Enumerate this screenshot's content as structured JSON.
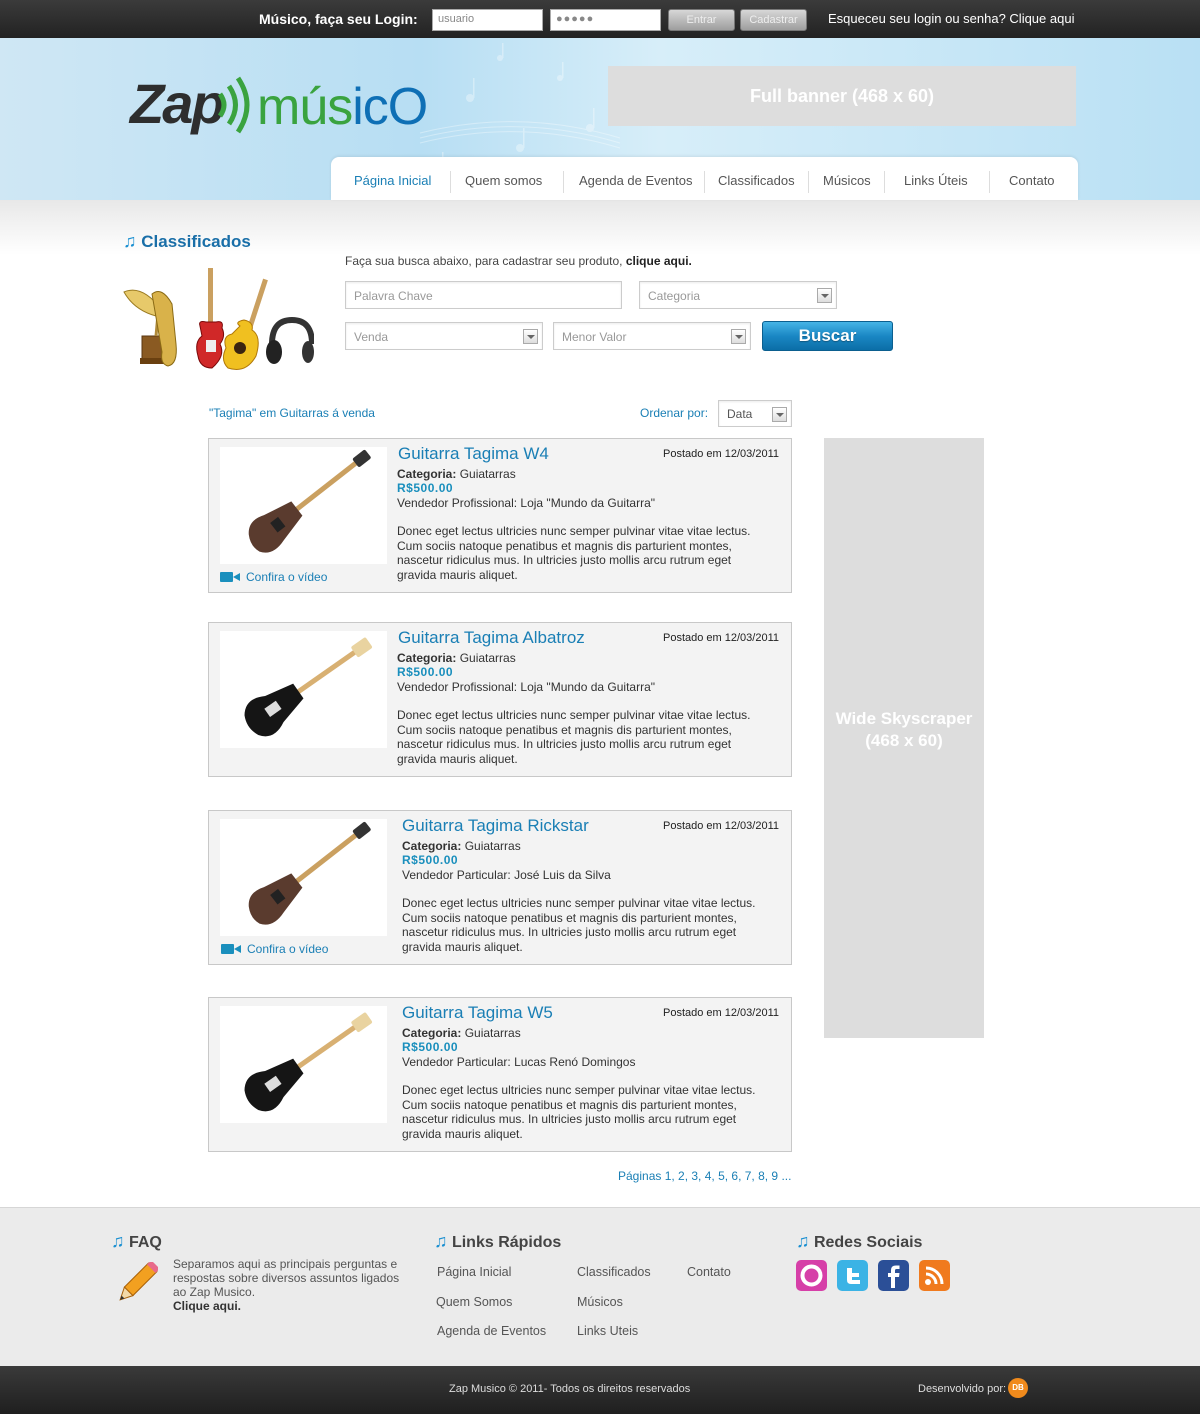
{
  "topbar": {
    "login_label": "Músico, faça seu Login:",
    "user_placeholder": "usuario",
    "password_mask": "●●●●●",
    "enter_label": "Entrar",
    "register_label": "Cadastrar",
    "forgot_text": "Esqueceu seu login ou senha? Clique aqui"
  },
  "logo": {
    "zap": "Zap",
    "musico_green": "mús",
    "musico_blue": "icO"
  },
  "banner": {
    "text": "Full banner (468 x 60)"
  },
  "nav": {
    "items": [
      {
        "label": "Página Inicial",
        "active": true
      },
      {
        "label": "Quem somos"
      },
      {
        "label": "Agenda de Eventos"
      },
      {
        "label": "Classificados"
      },
      {
        "label": "Músicos"
      },
      {
        "label": "Links Úteis"
      },
      {
        "label": "Contato"
      }
    ]
  },
  "section": {
    "title": "Classificados"
  },
  "search": {
    "hint_prefix": "Faça sua busca abaixo, para cadastrar seu produto,",
    "hint_link": "clique aqui.",
    "keyword_placeholder": "Palavra Chave",
    "category_value": "Categoria",
    "sale_value": "Venda",
    "min_value": "Menor Valor",
    "button_label": "Buscar"
  },
  "results": {
    "label": "\"Tagima\" em Guitarras á venda",
    "order_label": "Ordenar por:",
    "order_value": "Data"
  },
  "listings": [
    {
      "title": "Guitarra Tagima W4",
      "date": "Postado em 12/03/2011",
      "category_label": "Categoria:",
      "category": "Guiatarras",
      "price": "R$500.00",
      "seller": "Vendedor Profissional: Loja \"Mundo da Guitarra\"",
      "description": "Donec eget lectus ultricies nunc semper pulvinar vitae vitae lectus. Cum sociis natoque penatibus et magnis dis parturient montes, nascetur ridiculus mus. In ultricies justo mollis arcu rutrum eget gravida mauris aliquet.",
      "video": "Confira o vídeo",
      "guitar_color": "#5a3b2e"
    },
    {
      "title": "Guitarra Tagima Albatroz",
      "date": "Postado em 12/03/2011",
      "category_label": "Categoria:",
      "category": "Guiatarras",
      "price": "R$500.00",
      "seller": "Vendedor Profissional: Loja \"Mundo da Guitarra\"",
      "description": "Donec eget lectus ultricies nunc semper pulvinar vitae vitae lectus. Cum sociis natoque penatibus et magnis dis parturient montes, nascetur ridiculus mus. In ultricies justo mollis arcu rutrum eget gravida mauris aliquet.",
      "guitar_color": "#151515"
    },
    {
      "title": "Guitarra Tagima Rickstar",
      "date": "Postado em 12/03/2011",
      "category_label": "Categoria:",
      "category": "Guiatarras",
      "price": "R$500.00",
      "seller": "Vendedor Particular: José Luis da Silva",
      "description": "Donec eget lectus ultricies nunc semper pulvinar vitae vitae lectus. Cum sociis natoque penatibus et magnis dis parturient montes, nascetur ridiculus mus. In ultricies justo mollis arcu rutrum eget gravida mauris aliquet.",
      "video": "Confira o vídeo",
      "guitar_color": "#5a3b2e"
    },
    {
      "title": "Guitarra Tagima W5",
      "date": "Postado em 12/03/2011",
      "category_label": "Categoria:",
      "category": "Guiatarras",
      "price": "R$500.00",
      "seller": "Vendedor Particular: Lucas Renó Domingos",
      "description": "Donec eget lectus ultricies nunc semper pulvinar vitae vitae lectus. Cum sociis natoque penatibus et magnis dis parturient montes, nascetur ridiculus mus. In ultricies justo mollis arcu rutrum eget gravida mauris aliquet.",
      "guitar_color": "#151515"
    }
  ],
  "pagination": {
    "text": "Páginas 1, 2, 3, 4, 5, 6, 7, 8, 9 ..."
  },
  "skyscraper": {
    "line1": "Wide Skyscraper",
    "line2": "(468 x 60)"
  },
  "footer": {
    "faq_title": "FAQ",
    "faq_text": "Separamos aqui as principais perguntas e respostas sobre diversos assuntos ligados ao Zap Musico.",
    "faq_link": "Clique aqui.",
    "links_title": "Links Rápidos",
    "links": [
      "Página Inicial",
      "Quem Somos",
      "Agenda de Eventos",
      "Classificados",
      "Músicos",
      "Links Uteis",
      "Contato"
    ],
    "social_title": "Redes Sociais",
    "social": [
      {
        "icon": "orkut-icon",
        "color": "#d63fa8"
      },
      {
        "icon": "twitter-icon",
        "color": "#3bb3e5"
      },
      {
        "icon": "facebook-icon",
        "color": "#2b4f97"
      },
      {
        "icon": "rss-icon",
        "color": "#f07a1e"
      }
    ],
    "copyright": "Zap Musico © 2011- Todos os direitos reservados",
    "developed_by": "Desenvolvido por:",
    "dev_logo": "DB"
  }
}
